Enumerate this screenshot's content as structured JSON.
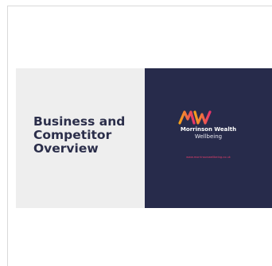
{
  "slide": {
    "title": "Business and\nCompetitor\nOverview",
    "brand": {
      "logo_icon": "mw-monogram-logo",
      "logo_letters": "MW",
      "name": "Morrinson Wealth",
      "subtitle": "Wellbeing",
      "website": "www.morrinsonwellbeing.co.uk"
    }
  },
  "colors": {
    "page_background": "#ffffff",
    "slide_left_background": "#eeeeee",
    "slide_right_background": "#272b4b",
    "title_text": "#2b2e4a",
    "logo_gradient_start": "#f7a21b",
    "logo_gradient_end": "#e8336b",
    "website_text": "#e83e6a"
  }
}
